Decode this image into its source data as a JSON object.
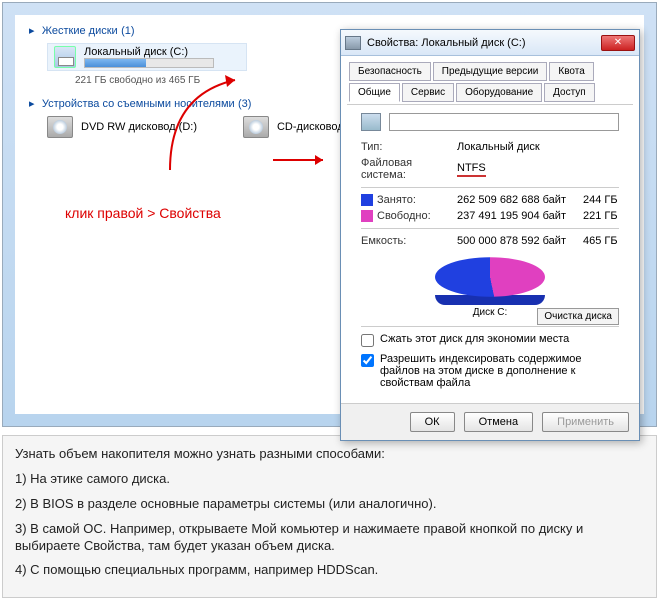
{
  "explorer": {
    "section_hdd": "Жесткие диски",
    "hdd_count": "(1)",
    "local_disk_label": "Локальный диск (C:)",
    "free_text": "221 ГБ свободно из 465 ГБ",
    "section_removable": "Устройства со съемными носителями",
    "removable_count": "(3)",
    "dvd_label": "DVD RW дисковод (D:)",
    "cd_label": "CD-дисковод"
  },
  "hint": "клик правой > Свойства",
  "dialog": {
    "title": "Свойства: Локальный диск (C:)",
    "tabs_r1": [
      "Безопасность",
      "Предыдущие версии",
      "Квота"
    ],
    "tabs_r2": [
      "Общие",
      "Сервис",
      "Оборудование",
      "Доступ"
    ],
    "type_lbl": "Тип:",
    "type_val": "Локальный диск",
    "fs_lbl": "Файловая система:",
    "fs_val": "NTFS",
    "used_lbl": "Занято:",
    "used_bytes": "262 509 682 688 байт",
    "used_gb": "244 ГБ",
    "free_lbl": "Свободно:",
    "free_bytes": "237 491 195 904 байт",
    "free_gb": "221 ГБ",
    "cap_lbl": "Емкость:",
    "cap_bytes": "500 000 878 592 байт",
    "cap_gb": "465 ГБ",
    "disk_label": "Диск C:",
    "clean_btn": "Очистка диска",
    "compress": "Сжать этот диск для экономии места",
    "index": "Разрешить индексировать содержимое файлов на этом диске в дополнение к свойствам файла",
    "ok": "ОК",
    "cancel": "Отмена",
    "apply": "Применить"
  },
  "caption": {
    "p0": "Узнать объем накопителя можно узнать разными способами:",
    "p1": "1) На этике самого диска.",
    "p2": "2) В BIOS в разделе основные параметры системы (или аналогично).",
    "p3": "3) В самой ОС. Например, открываете Мой комьютер и нажимаете правой кнопкой по диску и выбираете Свойства, там будет указан объем диска.",
    "p4": "4) С помощью специальных программ, например HDDScan."
  },
  "chart_data": {
    "type": "pie",
    "title": "Диск C:",
    "series": [
      {
        "name": "Занято",
        "value": 244,
        "unit": "ГБ",
        "color": "#2040e0"
      },
      {
        "name": "Свободно",
        "value": 221,
        "unit": "ГБ",
        "color": "#e040c0"
      }
    ]
  }
}
